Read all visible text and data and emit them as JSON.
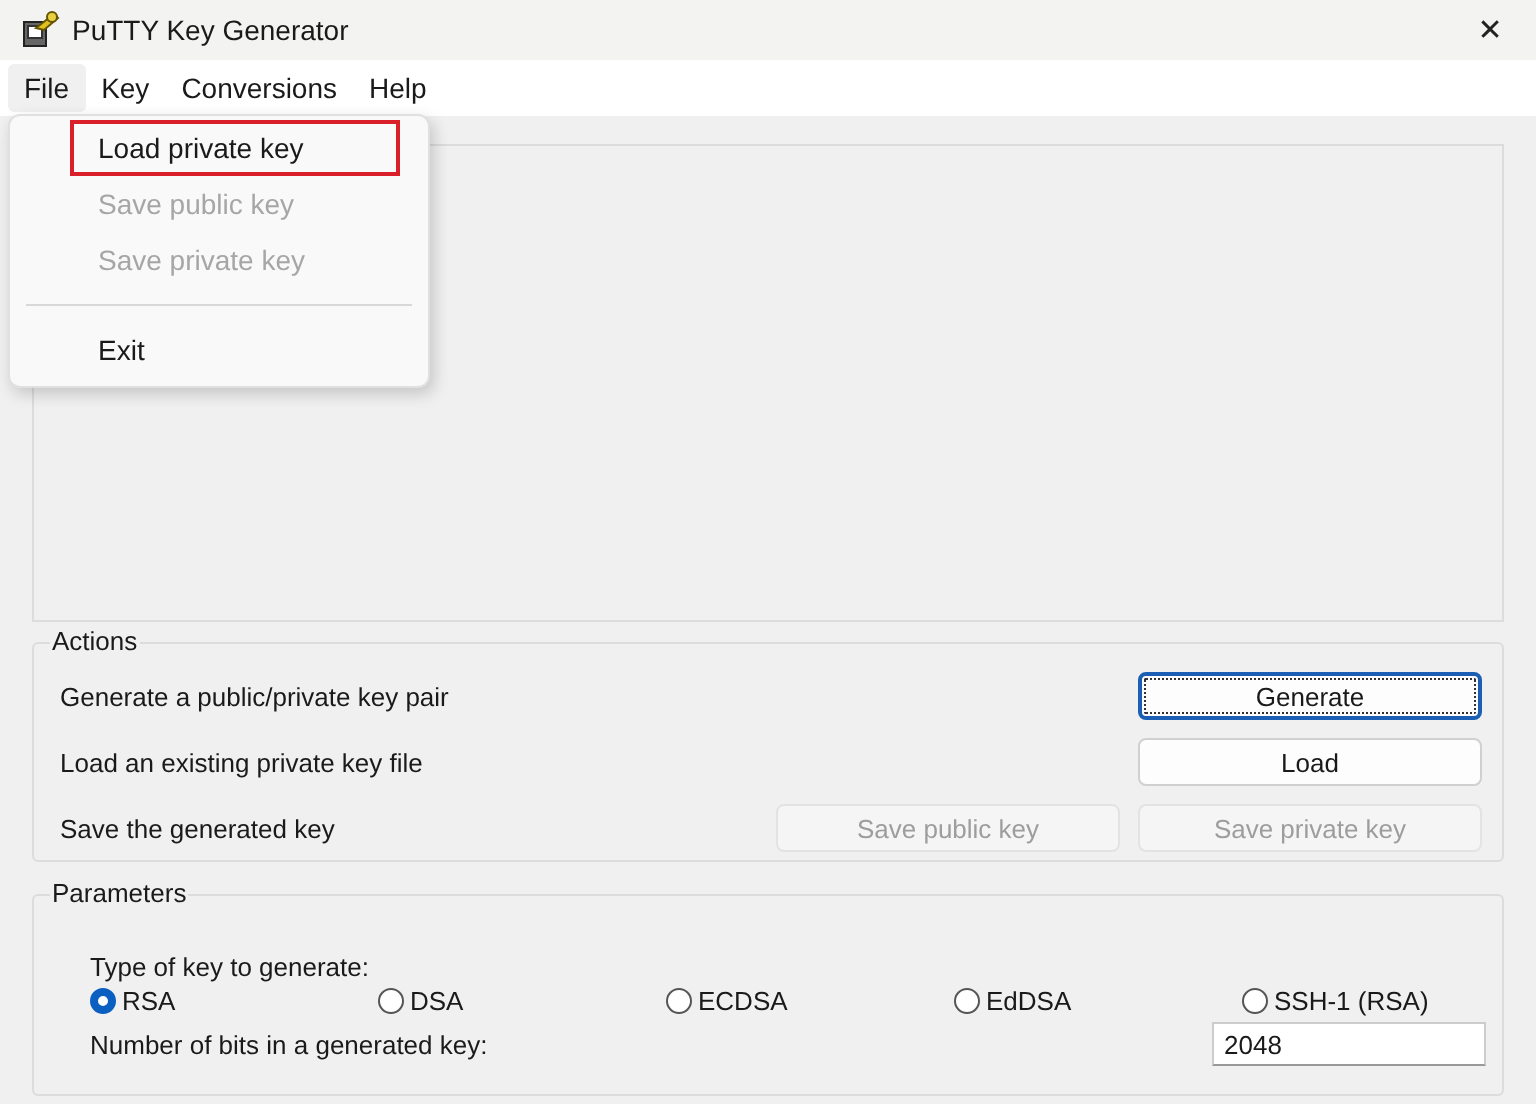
{
  "window": {
    "title": "PuTTY Key Generator",
    "close": "✕"
  },
  "menu_bar": [
    {
      "label": "File",
      "selected": true
    },
    {
      "label": "Key",
      "selected": false
    },
    {
      "label": "Conversions",
      "selected": false
    },
    {
      "label": "Help",
      "selected": false
    }
  ],
  "file_menu": [
    {
      "kind": "item",
      "label": "Load private key",
      "disabled": false,
      "highlighted": true
    },
    {
      "kind": "item",
      "label": "Save public key",
      "disabled": true,
      "highlighted": false
    },
    {
      "kind": "item",
      "label": "Save private key",
      "disabled": true,
      "highlighted": false
    },
    {
      "kind": "separator"
    },
    {
      "kind": "item",
      "label": "Exit",
      "disabled": false,
      "highlighted": false
    }
  ],
  "actions": {
    "title": "Actions",
    "rows": [
      {
        "label": "Generate a public/private key pair",
        "buttons": [
          {
            "label": "Generate",
            "disabled": false,
            "focused": true
          }
        ]
      },
      {
        "label": "Load an existing private key file",
        "buttons": [
          {
            "label": "Load",
            "disabled": false,
            "focused": false
          }
        ]
      },
      {
        "label": "Save the generated key",
        "buttons": [
          {
            "label": "Save public key",
            "disabled": true,
            "focused": false
          },
          {
            "label": "Save private key",
            "disabled": true,
            "focused": false
          }
        ]
      }
    ]
  },
  "parameters": {
    "title": "Parameters",
    "key_type_label": "Type of key to generate:",
    "key_types": [
      {
        "label": "RSA",
        "selected": true
      },
      {
        "label": "DSA",
        "selected": false
      },
      {
        "label": "ECDSA",
        "selected": false
      },
      {
        "label": "EdDSA",
        "selected": false
      },
      {
        "label": "SSH-1 (RSA)",
        "selected": false
      }
    ],
    "bits_label": "Number of bits in a generated key:",
    "bits_value": "2048"
  }
}
